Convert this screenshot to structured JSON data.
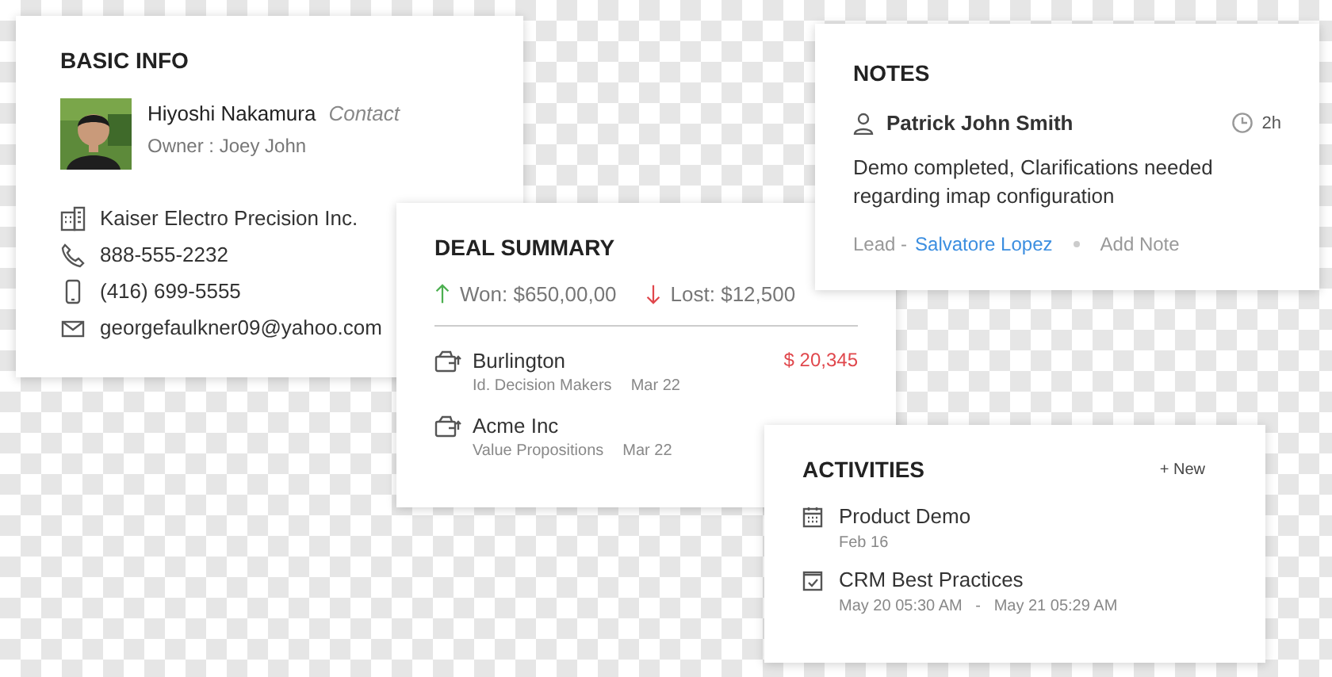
{
  "basic_info": {
    "title": "BASIC INFO",
    "contact": {
      "name": "Hiyoshi Nakamura",
      "role": "Contact",
      "owner": "Owner : Joey John"
    },
    "details": [
      {
        "kind": "company",
        "text": "Kaiser Electro Precision Inc."
      },
      {
        "kind": "phone",
        "text": "888-555-2232"
      },
      {
        "kind": "mobile",
        "text": "(416) 699-5555"
      },
      {
        "kind": "email",
        "text": "georgefaulkner09@yahoo.com"
      }
    ]
  },
  "deal_summary": {
    "title": "DEAL SUMMARY",
    "won": "Won: $650,00,00",
    "lost": "Lost: $12,500",
    "deals": [
      {
        "name": "Burlington",
        "stage": "Id. Decision Makers",
        "date": "Mar 22",
        "amount": "$ 20,345"
      },
      {
        "name": "Acme Inc",
        "stage": "Value Propositions",
        "date": "Mar 22"
      }
    ]
  },
  "notes": {
    "title": "NOTES",
    "author": "Patrick John Smith",
    "time": "2h",
    "body": "Demo completed, Clarifications needed regarding imap configuration",
    "lead_label": "Lead -",
    "lead_name": "Salvatore Lopez",
    "action": "Add Note"
  },
  "activities": {
    "title": "ACTIVITIES",
    "new_label": "+ New",
    "items": [
      {
        "kind": "event",
        "title": "Product Demo",
        "when": "Feb 16"
      },
      {
        "kind": "task",
        "title": "CRM Best Practices",
        "when": "May 20 05:30 AM   -   May 21 05:29 AM"
      }
    ]
  }
}
